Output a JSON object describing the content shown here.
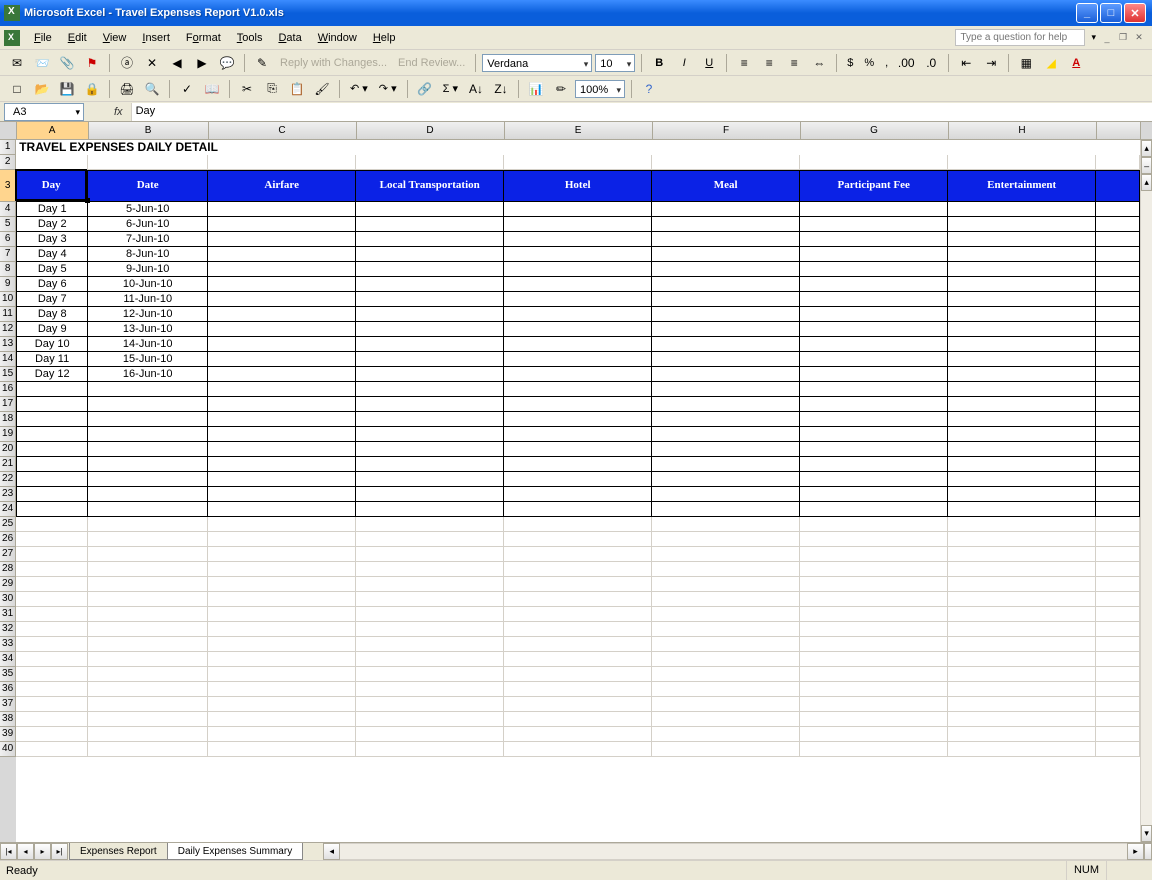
{
  "window": {
    "app_name": "Microsoft Excel",
    "doc_name": "Travel Expenses Report V1.0.xls"
  },
  "menu": [
    "File",
    "Edit",
    "View",
    "Insert",
    "Format",
    "Tools",
    "Data",
    "Window",
    "Help"
  ],
  "help_placeholder": "Type a question for help",
  "toolbar1": {
    "reply": "Reply with Changes...",
    "end_review": "End Review...",
    "font": "Verdana",
    "size": "10"
  },
  "toolbar2": {
    "zoom": "100%"
  },
  "formula": {
    "cell_ref": "A3",
    "fx": "fx",
    "value": "Day"
  },
  "columns": [
    "A",
    "B",
    "C",
    "D",
    "E",
    "F",
    "G",
    "H"
  ],
  "sheet": {
    "title": "TRAVEL EXPENSES DAILY DETAIL",
    "headers": [
      "Day",
      "Date",
      "Airfare",
      "Local Transportation",
      "Hotel",
      "Meal",
      "Participant Fee",
      "Entertainment"
    ],
    "rows": [
      {
        "day": "Day 1",
        "date": "5-Jun-10"
      },
      {
        "day": "Day 2",
        "date": "6-Jun-10"
      },
      {
        "day": "Day 3",
        "date": "7-Jun-10"
      },
      {
        "day": "Day 4",
        "date": "8-Jun-10"
      },
      {
        "day": "Day 5",
        "date": "9-Jun-10"
      },
      {
        "day": "Day 6",
        "date": "10-Jun-10"
      },
      {
        "day": "Day 7",
        "date": "11-Jun-10"
      },
      {
        "day": "Day 8",
        "date": "12-Jun-10"
      },
      {
        "day": "Day 9",
        "date": "13-Jun-10"
      },
      {
        "day": "Day 10",
        "date": "14-Jun-10"
      },
      {
        "day": "Day 11",
        "date": "15-Jun-10"
      },
      {
        "day": "Day 12",
        "date": "16-Jun-10"
      }
    ]
  },
  "tabs": {
    "nav": [
      "|◂",
      "◂",
      "▸",
      "▸|"
    ],
    "sheets": [
      "Expenses Report",
      "Daily Expenses Summary"
    ],
    "active": 1
  },
  "status": {
    "ready": "Ready",
    "num": "NUM"
  }
}
